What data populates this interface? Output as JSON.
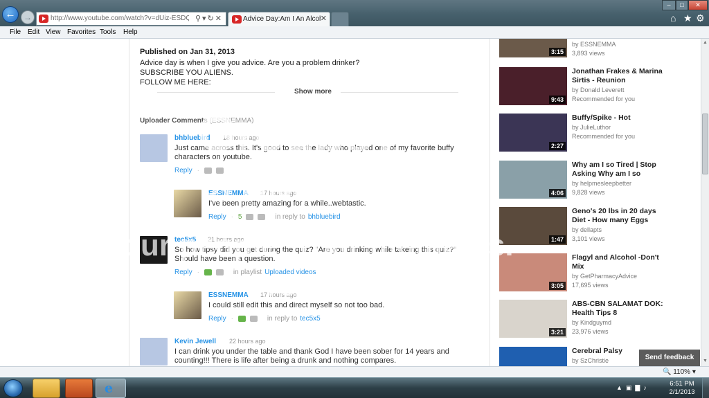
{
  "browser": {
    "url": "http://www.youtube.com/watch?v=dUiz-ESDQU8",
    "tab_title": "Advice Day:Am I An Alcoho...",
    "tab_close": "✕",
    "menu": [
      "File",
      "Edit",
      "View",
      "Favorites",
      "Tools",
      "Help"
    ],
    "zoom": "110%",
    "icons": {
      "back": "back-arrow-icon",
      "forward": "forward-arrow-icon",
      "home": "home-icon",
      "favorites": "star-icon",
      "tools": "gear-icon"
    }
  },
  "description": {
    "published": "Published on Jan 31, 2013",
    "text": "Advice day is when I give you advice. Are you a problem drinker?\nSUBSCRIBE YOU ALIENS.\nFOLLOW ME HERE:",
    "show_more": "Show more"
  },
  "uploader_comments": {
    "heading": "Uploader Comments",
    "channel": "(ESSNEMMA)"
  },
  "comments": [
    {
      "author": "bhbluebird",
      "time": "18 hours ago",
      "text": "Just came across this. It's good to see the lady who played one of my favorite buffy characters on youtube.",
      "reply_label": "Reply"
    },
    {
      "author": "ESSNEMMA",
      "time": "17 hours ago",
      "text": "I've been pretty amazing for a while..webtastic.",
      "reply_label": "Reply",
      "score": "5",
      "context": "in reply to",
      "context_link": "bhbluebird"
    },
    {
      "author": "tec5x5",
      "time": "21 hours ago",
      "text": "So how tipsy did you get during the quiz? \"Are you drinking while takeing this quiz?\" Should have been a question.",
      "reply_label": "Reply",
      "context": "in playlist",
      "context_link": "Uploaded videos"
    },
    {
      "author": "ESSNEMMA",
      "time": "17 hours ago",
      "text": "I could still edit this and direct myself so not too bad.",
      "reply_label": "Reply",
      "context": "in reply to",
      "context_link": "tec5x5"
    },
    {
      "author": "Kevin Jewell",
      "time": "22 hours ago",
      "text": "I can drink you under the table and thank God I have been sober for 14 years and counting!!! There is life after being a drunk and nothing compares."
    }
  ],
  "related": [
    {
      "title": "",
      "by": "by ESSNEMMA",
      "meta": "3,893 views",
      "duration": "3:15",
      "thumb_color": "#6b5a4a"
    },
    {
      "title": "Jonathan Frakes & Marina Sirtis - Reunion",
      "by": "by Donald Leverett",
      "meta": "Recommended for you",
      "duration": "9:43",
      "thumb_color": "#4a1f2a"
    },
    {
      "title": "Buffy/Spike - Hot",
      "by": "by JulieLuthor",
      "meta": "Recommended for you",
      "duration": "2:27",
      "thumb_color": "#3b3555"
    },
    {
      "title": "Why am I so Tired | Stop Asking Why am I so",
      "by": "by helpmesleepbetter",
      "meta": "9,828 views",
      "duration": "4:06",
      "thumb_color": "#8aa0a8"
    },
    {
      "title": "Geno's 20 lbs in 20 days Diet - How many Eggs",
      "by": "by dellapts",
      "meta": "3,101 views",
      "duration": "1:47",
      "thumb_color": "#5a4a3c"
    },
    {
      "title": "Flagyl and Alcohol -Don't Mix",
      "by": "by GetPharmacyAdvice",
      "meta": "17,695 views",
      "duration": "3:05",
      "thumb_color": "#c98a7a"
    },
    {
      "title": "ABS-CBN SALAMAT DOK: Health Tips 8",
      "by": "by Kindguymd",
      "meta": "23,976 views",
      "duration": "3:21",
      "thumb_color": "#d9d4cc"
    },
    {
      "title": "Cerebral Palsy",
      "by": "by SzChristie",
      "meta": "",
      "duration": "",
      "thumb_color": "#1f5fb0"
    }
  ],
  "feedback_button": "Send feedback",
  "watermark": {
    "logo": "Groupsy",
    "sub": "by photobucket",
    "line1": "Your people. Your moments.",
    "line2": "Your space."
  },
  "taskbar": {
    "time": "6:51 PM",
    "date": "2/1/2013"
  }
}
